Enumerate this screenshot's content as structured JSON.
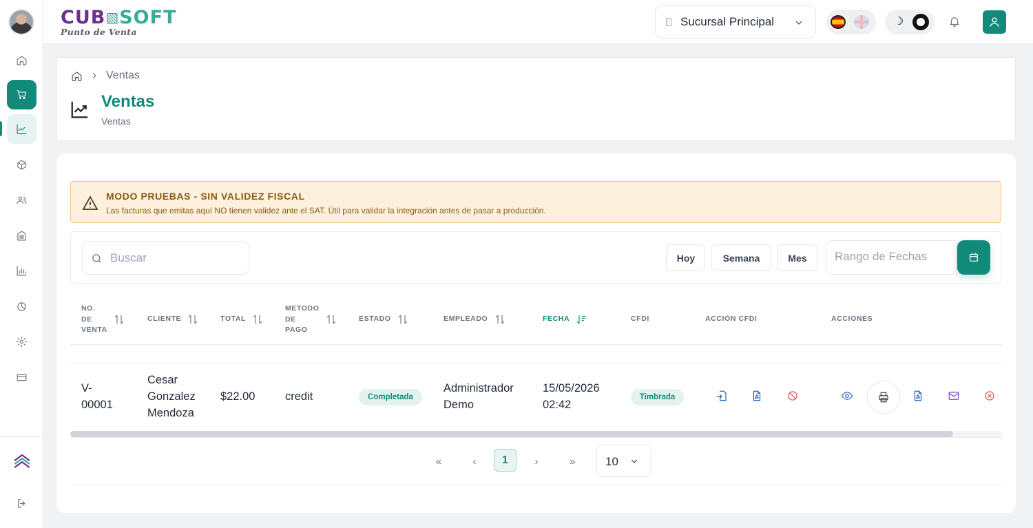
{
  "app": {
    "logo_part1": "CUB",
    "logo_part2": "SOFT",
    "logo_sub": "Punto de Venta"
  },
  "topbar": {
    "branch": "Sucursal Principal",
    "theme_moon": "☽"
  },
  "sidebar": {
    "items": [
      {
        "name": "home"
      },
      {
        "name": "cart",
        "active": true
      },
      {
        "name": "ventas",
        "selected": true
      },
      {
        "name": "box"
      },
      {
        "name": "users"
      },
      {
        "name": "building"
      },
      {
        "name": "reports"
      },
      {
        "name": "clock"
      },
      {
        "name": "settings"
      },
      {
        "name": "card"
      }
    ]
  },
  "header": {
    "breadcrumb": "Ventas",
    "title": "Ventas",
    "subtitle": "Ventas"
  },
  "alert": {
    "title": "MODO PRUEBAS - SIN VALIDEZ FISCAL",
    "text": "Las facturas que emitas aquí NO tienen validez ante el SAT. Útil para validar la integración antes de pasar a producción."
  },
  "filters": {
    "search_placeholder": "Buscar",
    "today": "Hoy",
    "week": "Semana",
    "month": "Mes",
    "range_placeholder": "Rango de Fechas"
  },
  "table": {
    "headers": {
      "no_venta": "NO.\nDE\nVENTA",
      "cliente": "CLIENTE",
      "total": "TOTAL",
      "metodo": "METODO\nDE\nPAGO",
      "estado": "ESTADO",
      "empleado": "EMPLEADO",
      "fecha": "FECHA",
      "cfdi": "CFDI",
      "accion_cfdi": "ACCIÓN CFDI",
      "acciones": "ACCIONES"
    },
    "rows": [
      {
        "no_venta": "V-\n00001",
        "cliente": "Cesar\nGonzalez\nMendoza",
        "total": "$22.00",
        "metodo": "credit",
        "estado": "Completada",
        "empleado": "Administrador\nDemo",
        "fecha": "15/05/2026\n02:42",
        "cfdi": "Timbrada"
      }
    ]
  },
  "pagination": {
    "first": "«",
    "prev": "‹",
    "current": "1",
    "next": "›",
    "last": "»",
    "per_page": "10"
  },
  "colors": {
    "accent": "#128a7a",
    "brand_purple": "#6b2f8f",
    "alert_bg": "#fdf0dd",
    "danger": "#e04848"
  }
}
